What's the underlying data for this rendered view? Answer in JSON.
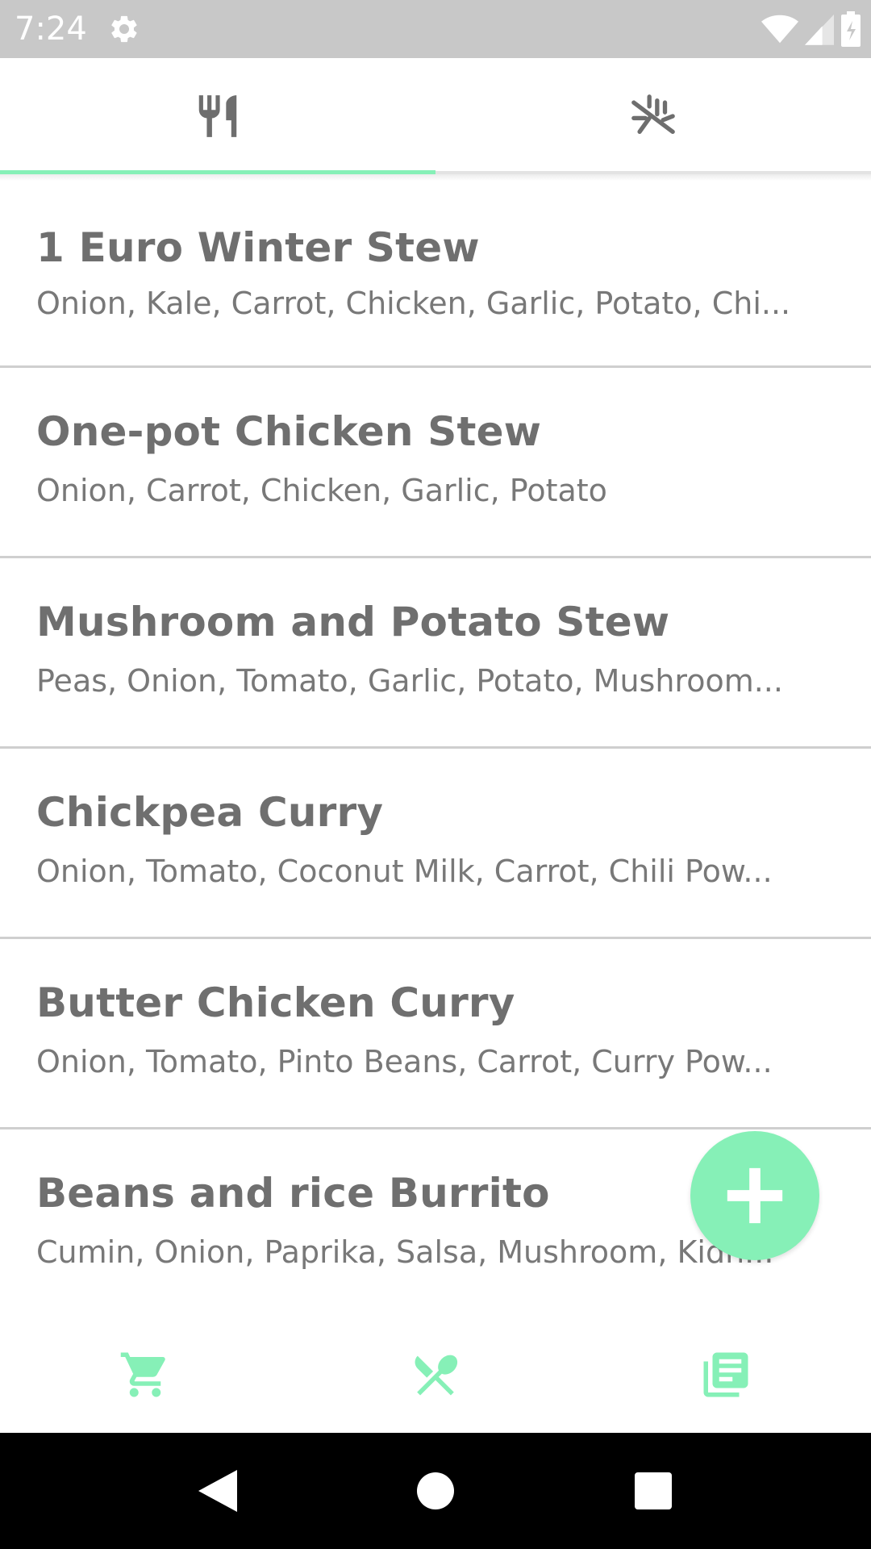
{
  "status_bar": {
    "time": "7:24",
    "icons": [
      "gear-icon",
      "wifi-icon",
      "cell-signal-icon",
      "battery-icon"
    ]
  },
  "tabs": [
    {
      "name": "recipes",
      "icon": "fork-knife-icon",
      "selected": true
    },
    {
      "name": "ingredients",
      "icon": "ingredients-icon",
      "selected": false
    }
  ],
  "recipes": [
    {
      "name": "1 Euro Winter Stew",
      "ingredients": "Onion, Kale, Carrot, Chicken, Garlic, Potato, Chi..."
    },
    {
      "name": "One-pot Chicken Stew",
      "ingredients": "Onion, Carrot, Chicken, Garlic, Potato"
    },
    {
      "name": "Mushroom and Potato Stew",
      "ingredients": "Peas, Onion, Tomato, Garlic, Potato, Mushroom..."
    },
    {
      "name": "Chickpea Curry",
      "ingredients": "Onion, Tomato, Coconut Milk, Carrot, Chili Pow..."
    },
    {
      "name": "Butter Chicken Curry",
      "ingredients": "Onion, Tomato, Pinto Beans, Carrot, Curry Pow..."
    },
    {
      "name": "Beans and rice Burrito",
      "ingredients": "Cumin, Onion, Paprika, Salsa, Mushroom, Kidn..."
    }
  ],
  "fab": {
    "icon": "plus-icon"
  },
  "bottom_nav": [
    {
      "name": "shopping-cart",
      "icon": "cart-icon"
    },
    {
      "name": "meals",
      "icon": "fork-spoon-icon"
    },
    {
      "name": "list",
      "icon": "list-icon"
    }
  ],
  "colors": {
    "accent": "#86f0b7",
    "status_bar": "#c8c8c8",
    "tab_icon": "#6e6e6e",
    "title_text": "#6f6f6f",
    "subtitle_text": "#787878",
    "divider": "#cfcfcf"
  }
}
